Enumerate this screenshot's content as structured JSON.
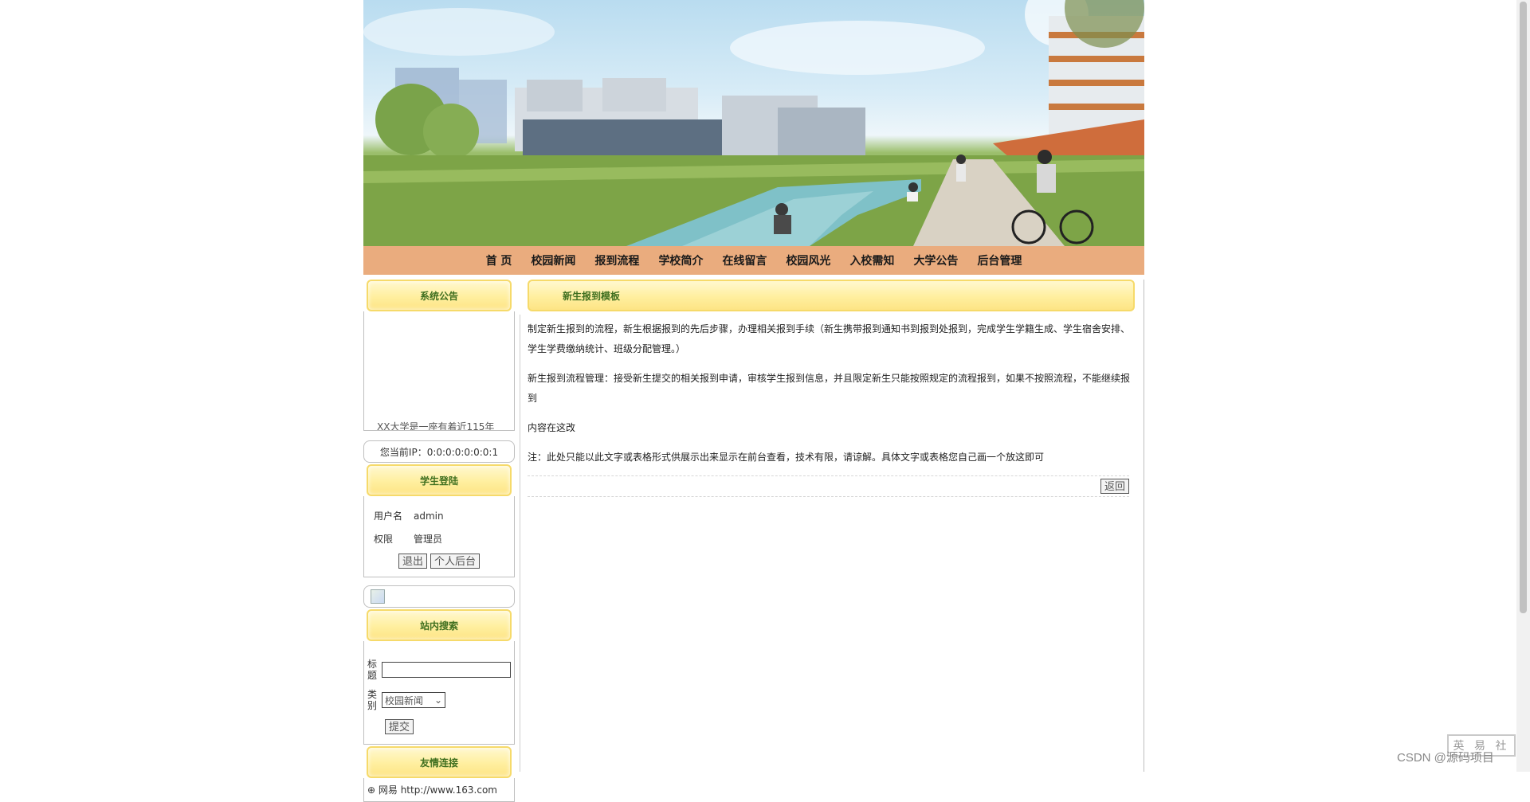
{
  "nav": {
    "items": [
      "首 页",
      "校园新闻",
      "报到流程",
      "学校简介",
      "在线留言",
      "校园风光",
      "入校需知",
      "大学公告",
      "后台管理"
    ]
  },
  "sidebar": {
    "notice_title": "系统公告",
    "notice_scroll_text": "XX大学是一座有着近115年",
    "ip_text": "您当前IP：0:0:0:0:0:0:0:1",
    "login_title": "学生登陆",
    "username_label": "用户名",
    "username_value": "admin",
    "role_label": "权限",
    "role_value": "管理员",
    "logout_label": "退出",
    "personal_label": "个人后台",
    "search_title": "站内搜索",
    "search_title_label": "标题",
    "search_category_label": "类别",
    "search_category_value": "校园新闻",
    "search_submit_label": "提交",
    "links_title": "友情连接",
    "links": [
      "网易 http://www.163.com"
    ]
  },
  "main": {
    "title": "新生报到模板",
    "paragraphs": [
      "制定新生报到的流程，新生根据报到的先后步骤，办理相关报到手续（新生携带报到通知书到报到处报到，完成学生学籍生成、学生宿舍安排、学生学费缴纳统计、班级分配管理。）",
      "新生报到流程管理：接受新生提交的相关报到申请，审核学生报到信息，并且限定新生只能按照规定的流程报到，如果不按照流程，不能继续报到",
      "内容在这改",
      "注：此处只能以此文字或表格形式供展示出来显示在前台查看，技术有限，请谅解。具体文字或表格您自己画一个放这即可"
    ],
    "back_label": "返回"
  },
  "watermark": {
    "text": "CSDN @源码项目",
    "stamp": "英 易 社"
  },
  "colors": {
    "nav_bg": "#eaac7e",
    "title_bg": "#ffef9f",
    "title_text": "#3f6f1f"
  }
}
